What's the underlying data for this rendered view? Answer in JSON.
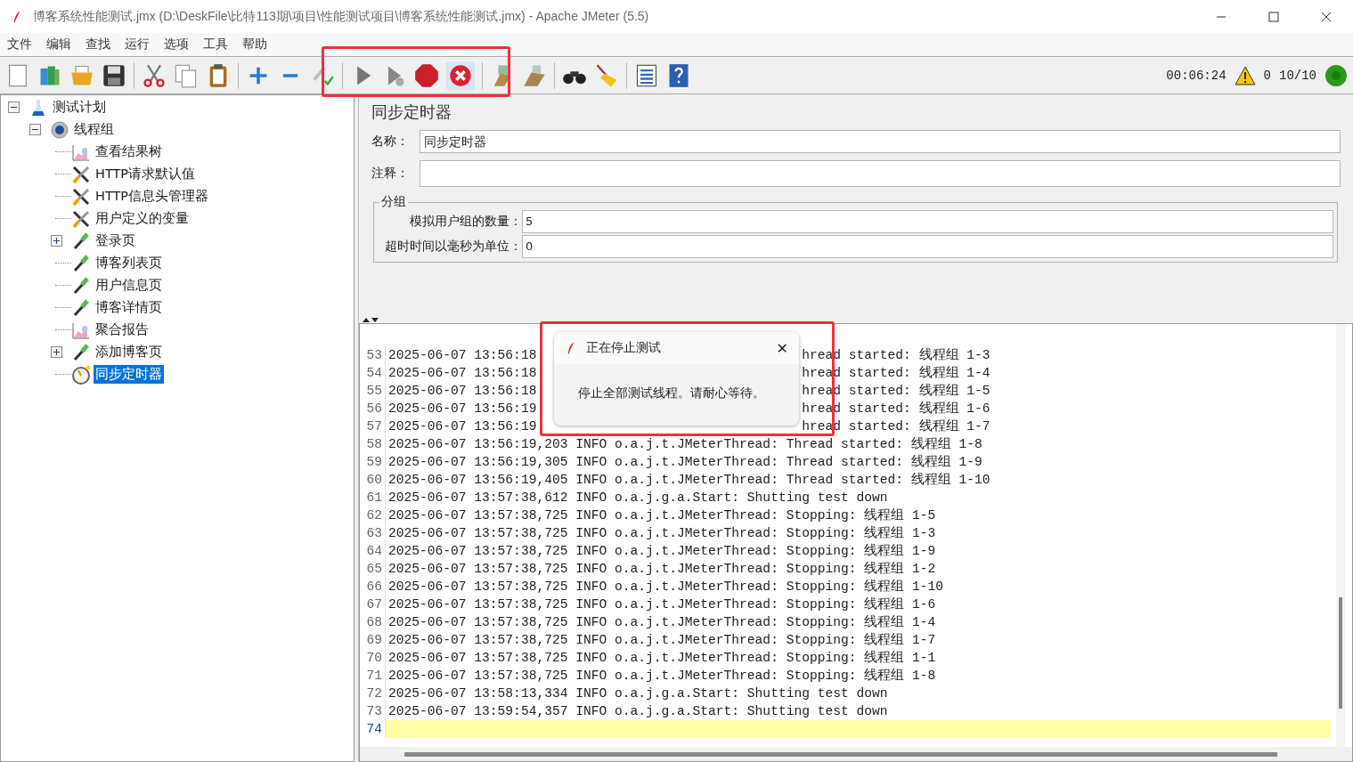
{
  "window": {
    "title": "博客系统性能测试.jmx (D:\\DeskFile\\比特113期\\项目\\性能测试项目\\博客系统性能测试.jmx) - Apache JMeter (5.5)"
  },
  "menu": [
    "文件",
    "编辑",
    "查找",
    "运行",
    "选项",
    "工具",
    "帮助"
  ],
  "status": {
    "elapsed": "00:06:24",
    "warnings": "0",
    "threads": "10/10"
  },
  "tree": [
    {
      "label": "测试计划",
      "kind": "plan",
      "expanded": true,
      "selected": false,
      "children": [
        {
          "label": "线程组",
          "kind": "threadgroup",
          "expanded": true,
          "selected": false,
          "children": [
            {
              "label": "查看结果树",
              "kind": "listener",
              "selected": false
            },
            {
              "label": "HTTP请求默认值",
              "kind": "config",
              "selected": false
            },
            {
              "label": "HTTP信息头管理器",
              "kind": "config",
              "selected": false
            },
            {
              "label": "用户定义的变量",
              "kind": "config",
              "selected": false
            },
            {
              "label": "登录页",
              "kind": "sampler",
              "expanded": false,
              "selected": false
            },
            {
              "label": "博客列表页",
              "kind": "sampler",
              "selected": false
            },
            {
              "label": "用户信息页",
              "kind": "sampler",
              "selected": false
            },
            {
              "label": "博客详情页",
              "kind": "sampler",
              "selected": false
            },
            {
              "label": "聚合报告",
              "kind": "listener",
              "selected": false
            },
            {
              "label": "添加博客页",
              "kind": "sampler",
              "expanded": false,
              "selected": false
            },
            {
              "label": "同步定时器",
              "kind": "timer",
              "selected": true
            }
          ]
        }
      ]
    }
  ],
  "form": {
    "title": "同步定时器",
    "name_label": "名称：",
    "name_value": "同步定时器",
    "comment_label": "注释：",
    "group_legend": "分组",
    "fields": [
      {
        "label": "模拟用户组的数量：",
        "value": "5"
      },
      {
        "label": "超时时间以毫秒为单位：",
        "value": "0"
      }
    ]
  },
  "log": [
    {
      "n": "53",
      "text": "2025-06-07 13:56:18",
      "tail": "hread started: 线程组 1-3",
      "current": false
    },
    {
      "n": "54",
      "text": "2025-06-07 13:56:18",
      "tail": "hread started: 线程组 1-4",
      "current": false
    },
    {
      "n": "55",
      "text": "2025-06-07 13:56:18",
      "tail": "hread started: 线程组 1-5",
      "current": false
    },
    {
      "n": "56",
      "text": "2025-06-07 13:56:19",
      "tail": "hread started: 线程组 1-6",
      "current": false
    },
    {
      "n": "57",
      "text": "2025-06-07 13:56:19",
      "tail": "hread started: 线程组 1-7",
      "current": false
    },
    {
      "n": "58",
      "text": "2025-06-07 13:56:19,203 INFO o.a.j.t.JMeterThread: Thread started: 线程组 1-8",
      "current": false
    },
    {
      "n": "59",
      "text": "2025-06-07 13:56:19,305 INFO o.a.j.t.JMeterThread: Thread started: 线程组 1-9",
      "current": false
    },
    {
      "n": "60",
      "text": "2025-06-07 13:56:19,405 INFO o.a.j.t.JMeterThread: Thread started: 线程组 1-10",
      "current": false
    },
    {
      "n": "61",
      "text": "2025-06-07 13:57:38,612 INFO o.a.j.g.a.Start: Shutting test down",
      "current": false
    },
    {
      "n": "62",
      "text": "2025-06-07 13:57:38,725 INFO o.a.j.t.JMeterThread: Stopping: 线程组 1-5",
      "current": false
    },
    {
      "n": "63",
      "text": "2025-06-07 13:57:38,725 INFO o.a.j.t.JMeterThread: Stopping: 线程组 1-3",
      "current": false
    },
    {
      "n": "64",
      "text": "2025-06-07 13:57:38,725 INFO o.a.j.t.JMeterThread: Stopping: 线程组 1-9",
      "current": false
    },
    {
      "n": "65",
      "text": "2025-06-07 13:57:38,725 INFO o.a.j.t.JMeterThread: Stopping: 线程组 1-2",
      "current": false
    },
    {
      "n": "66",
      "text": "2025-06-07 13:57:38,725 INFO o.a.j.t.JMeterThread: Stopping: 线程组 1-10",
      "current": false
    },
    {
      "n": "67",
      "text": "2025-06-07 13:57:38,725 INFO o.a.j.t.JMeterThread: Stopping: 线程组 1-6",
      "current": false
    },
    {
      "n": "68",
      "text": "2025-06-07 13:57:38,725 INFO o.a.j.t.JMeterThread: Stopping: 线程组 1-4",
      "current": false
    },
    {
      "n": "69",
      "text": "2025-06-07 13:57:38,725 INFO o.a.j.t.JMeterThread: Stopping: 线程组 1-7",
      "current": false
    },
    {
      "n": "70",
      "text": "2025-06-07 13:57:38,725 INFO o.a.j.t.JMeterThread: Stopping: 线程组 1-1",
      "current": false
    },
    {
      "n": "71",
      "text": "2025-06-07 13:57:38,725 INFO o.a.j.t.JMeterThread: Stopping: 线程组 1-8",
      "current": false
    },
    {
      "n": "72",
      "text": "2025-06-07 13:58:13,334 INFO o.a.j.g.a.Start: Shutting test down",
      "current": false
    },
    {
      "n": "73",
      "text": "2025-06-07 13:59:54,357 INFO o.a.j.g.a.Start: Shutting test down",
      "current": false
    },
    {
      "n": "74",
      "current": true
    }
  ],
  "dialog": {
    "title": "正在停止测试",
    "message": "停止全部测试线程。请耐心等待。",
    "close": "✕"
  }
}
